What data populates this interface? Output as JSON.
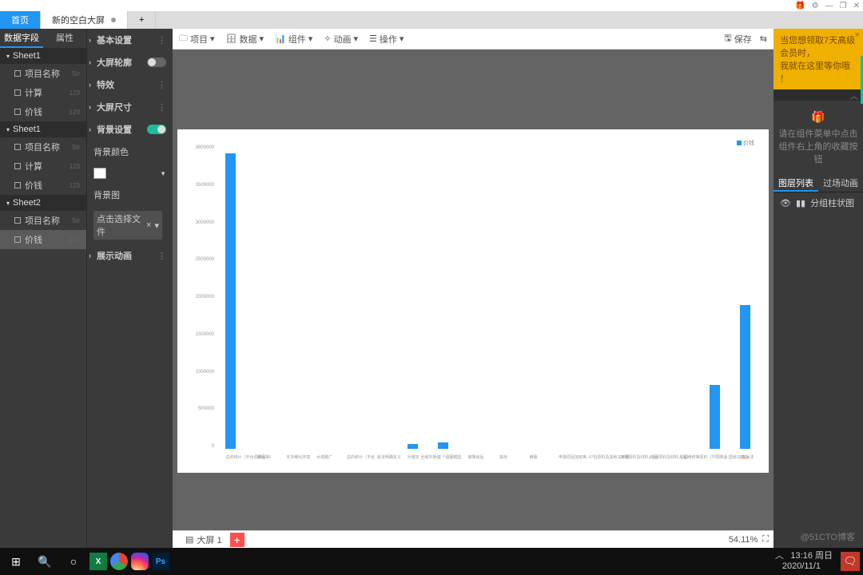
{
  "titlebar": {
    "gift": "🎁",
    "settings": "⚙",
    "min": "—",
    "max": "❐",
    "close": "✕"
  },
  "tabs": {
    "home": "首页",
    "active": "新的空白大屏",
    "plus": "+"
  },
  "leftTabs": {
    "data": "数据字段",
    "props": "属性"
  },
  "sheets": [
    {
      "name": "Sheet1",
      "fields": [
        {
          "n": "项目名称",
          "t": "Str"
        },
        {
          "n": "计算",
          "t": "123"
        },
        {
          "n": "价钱",
          "t": "123"
        }
      ]
    },
    {
      "name": "Sheet1",
      "fields": [
        {
          "n": "项目名称",
          "t": "Str"
        },
        {
          "n": "计算",
          "t": "123"
        },
        {
          "n": "价钱",
          "t": "123"
        }
      ]
    },
    {
      "name": "Sheet2",
      "fields": [
        {
          "n": "项目名称",
          "t": "Str"
        },
        {
          "n": "价钱",
          "t": "123"
        }
      ]
    }
  ],
  "props": {
    "basic": "基本设置",
    "outline": "大屏轮廓",
    "effect": "特效",
    "size": "大屏尺寸",
    "bg": "背景设置",
    "bgcolor": "背景颜色",
    "bgimg": "背景图",
    "bgimg_sel": "点击选择文件",
    "anim": "展示动画"
  },
  "toolbar": {
    "project": "项目",
    "data": "数据",
    "widget": "组件",
    "anim": "动画",
    "action": "操作",
    "save": "保存"
  },
  "promo": {
    "l1": "当您想领取7天高级会员时，",
    "l2": "我就在这里等你哦 ！"
  },
  "hint": {
    "l1": "请在组件菜单中点击",
    "l2": "组件右上角的收藏按钮"
  },
  "rightTabs": {
    "layers": "图层列表",
    "trans": "过场动画"
  },
  "layer": {
    "name": "分组柱状图"
  },
  "bottom": {
    "page": "大屏 1",
    "zoom": "54.11%"
  },
  "clock": {
    "time": "13:16 周日",
    "date": "2020/11/1"
  },
  "watermark": "@51CTO博客",
  "chart_data": {
    "type": "bar",
    "legend": "价钱",
    "ylim": [
      0,
      3800000
    ],
    "yticks": [
      "0",
      "500000",
      "1000000",
      "1500000",
      "2000000",
      "2500000",
      "3000000",
      "3500000",
      "3800000"
    ],
    "categories": [
      "总的统计（不含调味品等）",
      "其他",
      "无法细化环境",
      "水塔路厂",
      "总的统计（不含...）",
      "无法明确定义",
      "月缴定 全域市场化",
      "三个圆圈模型",
      "被降级后",
      "其他",
      "精製",
      "申报原因加班等",
      "67包原料及其他三敏感",
      "(不明原料及材料入品)",
      "(不明原料及材料入品)",
      "空调维修等原料",
      "(不限降温-国道)加热大法",
      "售后"
    ],
    "values": [
      3700000,
      0,
      0,
      0,
      0,
      0,
      60000,
      80000,
      0,
      0,
      0,
      0,
      0,
      0,
      0,
      0,
      800000,
      1800000
    ]
  }
}
